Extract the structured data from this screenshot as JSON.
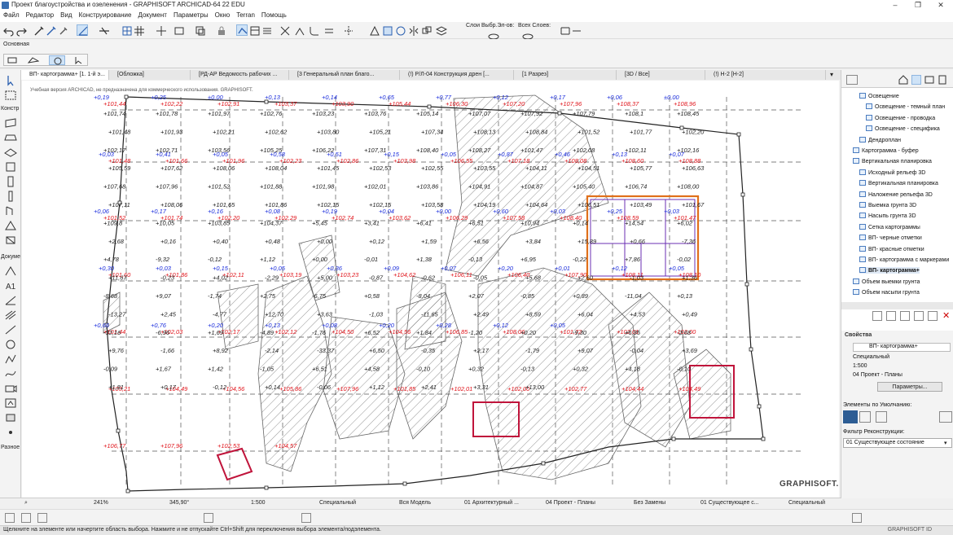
{
  "window": {
    "title": "Проект благоустройства и озеленения - GRAPHISOFT ARCHICAD-64 22 EDU",
    "controls": [
      "–",
      "❐",
      "✕"
    ]
  },
  "menu": [
    "Файл",
    "Редактор",
    "Вид",
    "Конструирование",
    "Документ",
    "Параметры",
    "Окно",
    "Terran",
    "Помощь"
  ],
  "toolbar": {
    "layers_label": "Слои Выбр.Эл-ов:",
    "all_layers_label": "Всех Слоев:"
  },
  "infobox": {
    "label": "Основная"
  },
  "left_toolbox": {
    "sections": [
      "Констр",
      "Докуме",
      "Разное"
    ]
  },
  "tabs": [
    "ВП- картограмма+ [1. 1-й э...",
    "[Обложка]",
    "[РД-АР Ведомость рабочих ...",
    "[3 Генеральный план благо...",
    "(!) Р/Л-04 Конструкция дрен [...",
    "[1 Разрез]",
    "[3D / Все]",
    "(!) Н-2 [Н-2]"
  ],
  "canvas": {
    "watermark": "Учебная версия ARCHICAD, не предназначена для коммерческого использования. GRAPHISOFT.",
    "logo": "GRAPHISOFT.",
    "red_labels": [
      "+101,44",
      "+102,22",
      "+102,91",
      "+103,37",
      "+103,90",
      "+105,44",
      "+106,30",
      "+107,20",
      "+107,96",
      "+108,37",
      "+108,96",
      "+101,48",
      "+101,66",
      "+101,96",
      "+102,23",
      "+102,86",
      "+103,98",
      "+106,55",
      "+107,18",
      "+108,08",
      "+108,60",
      "+108,88",
      "+101,52",
      "+101,74",
      "+102,20",
      "+102,29",
      "+102,74",
      "+103,62",
      "+106,29",
      "+107,58",
      "+108,40",
      "+108,59",
      "+101,47",
      "+101,60",
      "+101,86",
      "+102,11",
      "+103,19",
      "+103,23",
      "+104,62",
      "+106,11",
      "+106,40",
      "+107,90",
      "+108,11",
      "+108,10",
      "+101,44",
      "+102,03",
      "+102,17",
      "+102,12",
      "+104,50",
      "+104,56",
      "+106,85",
      "+108,06",
      "+101,72",
      "+102,01",
      "+102,00",
      "+103,21",
      "+104,49",
      "+104,56",
      "+105,86",
      "+107,96",
      "+101,85",
      "+102,01",
      "+102,00",
      "+102,77",
      "+104,44",
      "+104,49",
      "+106,77",
      "+107,96",
      "+102,53",
      "+104,57"
    ],
    "blue_labels": [
      "+0,19",
      "+0,25",
      "±0,00",
      "+0,13",
      "+0,14",
      "+0,65",
      "+0,77",
      "+0,12",
      "+0,17",
      "+0,06",
      "±0,00",
      "+0,03",
      "+0,41",
      "+0,05",
      "+0,58",
      "+0,51",
      "+0,15",
      "+0,05",
      "+0,87",
      "+0,46",
      "+0,13",
      "+0,07",
      "+0,06",
      "+0,17",
      "+0,16",
      "+0,08",
      "+0,19",
      "+0,04",
      "+0,00",
      "+0,60",
      "+0,03",
      "+0,25",
      "+0,03",
      "+0,30",
      "+0,03",
      "+0,15",
      "+0,05",
      "+0,36",
      "+0,09",
      "+0,07",
      "+0,20",
      "+0,01",
      "+0,12",
      "+0,05",
      "+0,66",
      "+0,76",
      "+0,20",
      "+0,13",
      "+0,08",
      "+0,20",
      "+0,28",
      "+0,12",
      "+0,05"
    ],
    "black_labels": [
      "+101,74",
      "+101,78",
      "+101,97",
      "+102,76",
      "+103,23",
      "+103,76",
      "+105,14",
      "+107,07",
      "+107,92",
      "+107,79",
      "+108,1",
      "+108,45",
      "+101,48",
      "+101,93",
      "+102,21",
      "+102,62",
      "+103,80",
      "+105,21",
      "+107,34",
      "+108,13",
      "+108,84",
      "+101,52",
      "+101,77",
      "+102,20",
      "+102,17",
      "+102,71",
      "+103,56",
      "+105,25",
      "+106,22",
      "+107,31",
      "+108,40",
      "+108,27",
      "+101,47",
      "+102,08",
      "+102,11",
      "+102,16",
      "+105,59",
      "+107,62",
      "+108,06",
      "+108,04",
      "+101,45",
      "+102,53",
      "+102,55",
      "+103,55",
      "+104,11",
      "+104,51",
      "+105,77",
      "+106,63",
      "+107,68",
      "+107,96",
      "+101,52",
      "+101,88",
      "+101,98",
      "+102,01",
      "+103,86",
      "+104,91",
      "+104,87",
      "+105,40",
      "+106,74",
      "+108,00",
      "+107,11",
      "+108,06",
      "+101,65",
      "+101,86",
      "+102,15",
      "+102,15",
      "+103,58",
      "+104,19",
      "+104,64",
      "+106,51",
      "+103,49",
      "+101,67",
      "+109,8",
      "+10,05",
      "+103,85",
      "+104,37",
      "+5,45",
      "+3,41",
      "+6,41",
      "+6,51",
      "+10,94",
      "+0,14",
      "+14,54",
      "+6,02",
      "+2,68",
      "+0,16",
      "+0,40",
      "+0,48",
      "+0,00",
      "+0,12",
      "+1,59",
      "+6,56",
      "+3,84",
      "+15,89",
      "+0,66",
      "-7,36",
      "+4,78",
      "-9,32",
      "-0,12",
      "+1,12",
      "+0,00",
      "-0,01",
      "+1,38",
      "-0,13",
      "+6,95",
      "-0,22",
      "+7,86",
      "-0,02",
      "+11,67",
      "-0,23",
      "+4,02",
      "-2,29",
      "+5,00",
      "-0,87",
      "-0,62",
      "-0,05",
      "+5,68",
      "+2,60",
      "-1,03",
      "+1,36",
      "-8,68",
      "+9,07",
      "-1,74",
      "+2,75",
      "-6,75",
      "+0,58",
      "-8,04",
      "+2,07",
      "-0,85",
      "+0,89",
      "-11,04",
      "+0,13",
      "-13,27",
      "+2,45",
      "-4,77",
      "+12,70",
      "+3,63",
      "-1,03",
      "-11,65",
      "+2,49",
      "+8,59",
      "+6,04",
      "+4,53",
      "+0,49",
      "-32,16",
      "-6,96",
      "+1,69",
      "-4,89",
      "-1,76",
      "+6,52",
      "+1,84",
      "-1,20",
      "+0,20",
      "-9,30",
      "+6,35",
      "-2,68",
      "+9,76",
      "-1,66",
      "+8,92",
      "-2,14",
      "-33,37",
      "+6,50",
      "-0,35",
      "+2,17",
      "-1,79",
      "+9,07",
      "-0,04",
      "+3,69",
      "-0,09",
      "+1,67",
      "+1,42",
      "-1,05",
      "+6,51",
      "+4,58",
      "-0,10",
      "+0,32",
      "-0,13",
      "+0,32",
      "+4,18",
      "-0,10",
      "+1,81",
      "+0,17",
      "-0,12",
      "+0,14",
      "-0,06",
      "+1,12",
      "+2,41",
      "+3,31",
      "+13,00"
    ]
  },
  "navigator": {
    "items": [
      "Освещение",
      "Освещение - темный план",
      "Освещение - проводка",
      "Освещение - специфика",
      "Дендроплан",
      "Картограмма - буфер",
      "Вертикальная планировка",
      "Исходный рельеф 3D",
      "Вертикальная планировка",
      "Наложение рельефа 3D",
      "Выемка грунта 3D",
      "Насыпь грунта 3D",
      "Сетка картограммы",
      "ВП- черные отметки",
      "ВП- красные отметки",
      "ВП- картограмма с маркерами",
      "ВП- картограмма+",
      "Объем выемки грунта",
      "Объем насыпи грунта"
    ]
  },
  "properties": {
    "header": "Свойства",
    "view_name": "ВП- картограмма+",
    "type": "Специальный",
    "scale": "1:500",
    "layer_combo": "04 Проект - Планы",
    "params_button": "Параметры...",
    "defaults_label": "Элементы по Умолчанию:",
    "filter_label": "Фильтр Реконструкции:",
    "filter_value": "01 Существующее состояние"
  },
  "bottombar": {
    "zoom": "241%",
    "angle": "345,90°",
    "scale": "1:500",
    "structure": "Специальный",
    "model": "Вся Модель",
    "layers": "01 Архитектурный ...",
    "layers2": "04 Проект - Планы",
    "override": "Без Замены",
    "reno": "01 Существующее с...",
    "special": "Специальный"
  },
  "status": {
    "text": "Щелкните на элементе или начертите область выбора. Нажмите и не отпускайте Ctrl+Shift для переключения выбора элемента/подэлемента.",
    "id": "GRAPHISOFT ID"
  },
  "colors": {
    "red": "#e0141b",
    "blue": "#1a2cdc",
    "hatch": "#777777",
    "accent": "#3a6fb0"
  }
}
